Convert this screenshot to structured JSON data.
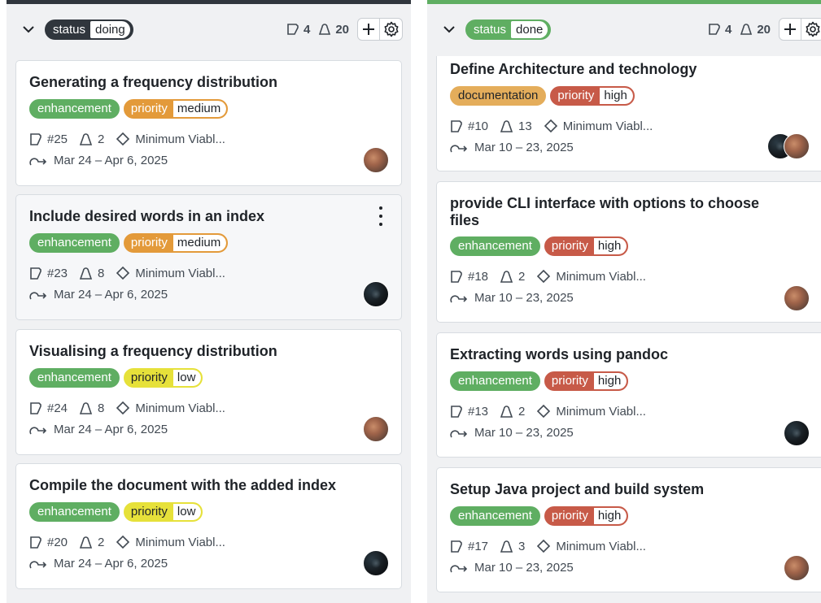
{
  "columns": [
    {
      "status_key": "status",
      "status_value": "doing",
      "issue_count": "4",
      "estimate_total": "20",
      "cards": [
        {
          "title": "Generating a frequency distribution",
          "type_label": "enhancement",
          "priority_key": "priority",
          "priority_value": "medium",
          "number": "#25",
          "estimate": "2",
          "milestone": "Minimum Viabl...",
          "dates": "Mar 24 – Apr 6, 2025",
          "avatar": "photo"
        },
        {
          "title": "Include desired words in an index",
          "type_label": "enhancement",
          "priority_key": "priority",
          "priority_value": "medium",
          "number": "#23",
          "estimate": "8",
          "milestone": "Minimum Viabl...",
          "dates": "Mar 24 – Apr 6, 2025",
          "avatar": "dark"
        },
        {
          "title": "Visualising a frequency distribution",
          "type_label": "enhancement",
          "priority_key": "priority",
          "priority_value": "low",
          "number": "#24",
          "estimate": "8",
          "milestone": "Minimum Viabl...",
          "dates": "Mar 24 – Apr 6, 2025",
          "avatar": "photo"
        },
        {
          "title": "Compile the document with the added index",
          "type_label": "enhancement",
          "priority_key": "priority",
          "priority_value": "low",
          "number": "#20",
          "estimate": "2",
          "milestone": "Minimum Viabl...",
          "dates": "Mar 24 – Apr 6, 2025",
          "avatar": "dark"
        }
      ]
    },
    {
      "status_key": "status",
      "status_value": "done",
      "issue_count": "4",
      "estimate_total": "20",
      "cards": [
        {
          "title": "Define Architecture and technology",
          "type_label": "documentation",
          "priority_key": "priority",
          "priority_value": "high",
          "number": "#10",
          "estimate": "13",
          "milestone": "Minimum Viabl...",
          "dates": "Mar 10 – 23, 2025",
          "avatar": "both"
        },
        {
          "title": "provide CLI interface with options to choose files",
          "type_label": "enhancement",
          "priority_key": "priority",
          "priority_value": "high",
          "number": "#18",
          "estimate": "2",
          "milestone": "Minimum Viabl...",
          "dates": "Mar 10 – 23, 2025",
          "avatar": "photo"
        },
        {
          "title": "Extracting words using pandoc",
          "type_label": "enhancement",
          "priority_key": "priority",
          "priority_value": "high",
          "number": "#13",
          "estimate": "2",
          "milestone": "Minimum Viabl...",
          "dates": "Mar 10 – 23, 2025",
          "avatar": "dark"
        },
        {
          "title": "Setup Java project and build system",
          "type_label": "enhancement",
          "priority_key": "priority",
          "priority_value": "high",
          "number": "#17",
          "estimate": "3",
          "milestone": "Minimum Viabl...",
          "dates": "Mar 10 – 23, 2025",
          "avatar": "photo"
        }
      ]
    }
  ],
  "colors": {
    "enhancement": "#5fae62",
    "documentation": "#e4ad5b",
    "priority_medium": "#e39a3a",
    "priority_low": "#e6e13a",
    "priority_high": "#c75a48",
    "status_doing": "#30363d",
    "status_done": "#5fae62"
  }
}
